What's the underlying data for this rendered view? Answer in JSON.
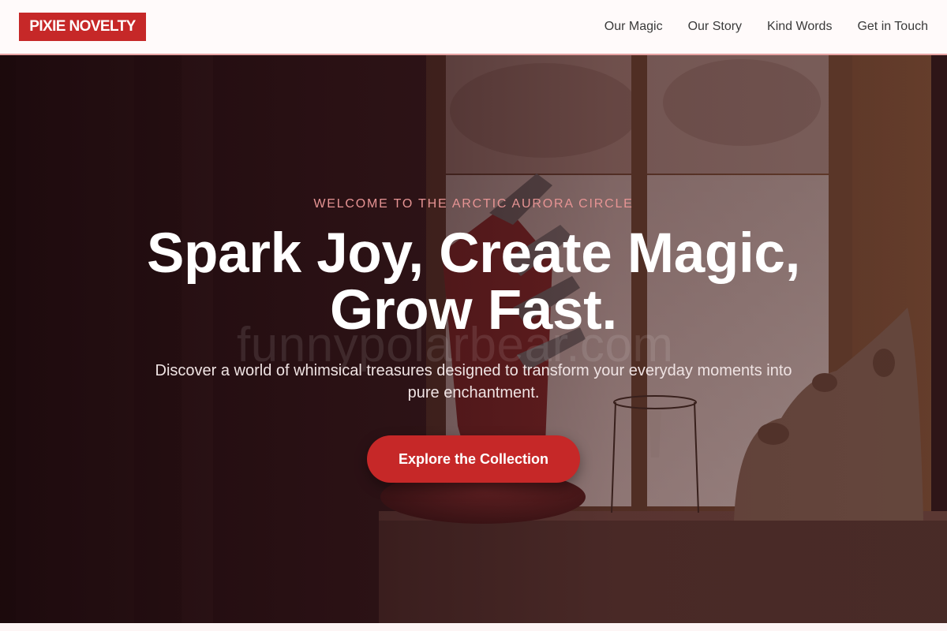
{
  "brand": {
    "logo_text": "PIXIE NOVELTY",
    "accent_color": "#c62828"
  },
  "nav": {
    "links": [
      {
        "label": "Our Magic"
      },
      {
        "label": "Our Story"
      },
      {
        "label": "Kind Words"
      },
      {
        "label": "Get in Touch"
      }
    ]
  },
  "hero": {
    "eyebrow": "WELCOME TO THE ARCTIC AURORA CIRCLE",
    "headline_line1": "Spark Joy, Create Magic,",
    "headline_line2": "Grow Fast.",
    "subtext": "Discover a world of whimsical treasures designed to transform your everyday moments into pure enchantment.",
    "cta_label": "Explore the Collection",
    "watermark": "funnypolarbear.com",
    "background_image": "window-sill-with-knife-block-and-ceramic-bears"
  }
}
